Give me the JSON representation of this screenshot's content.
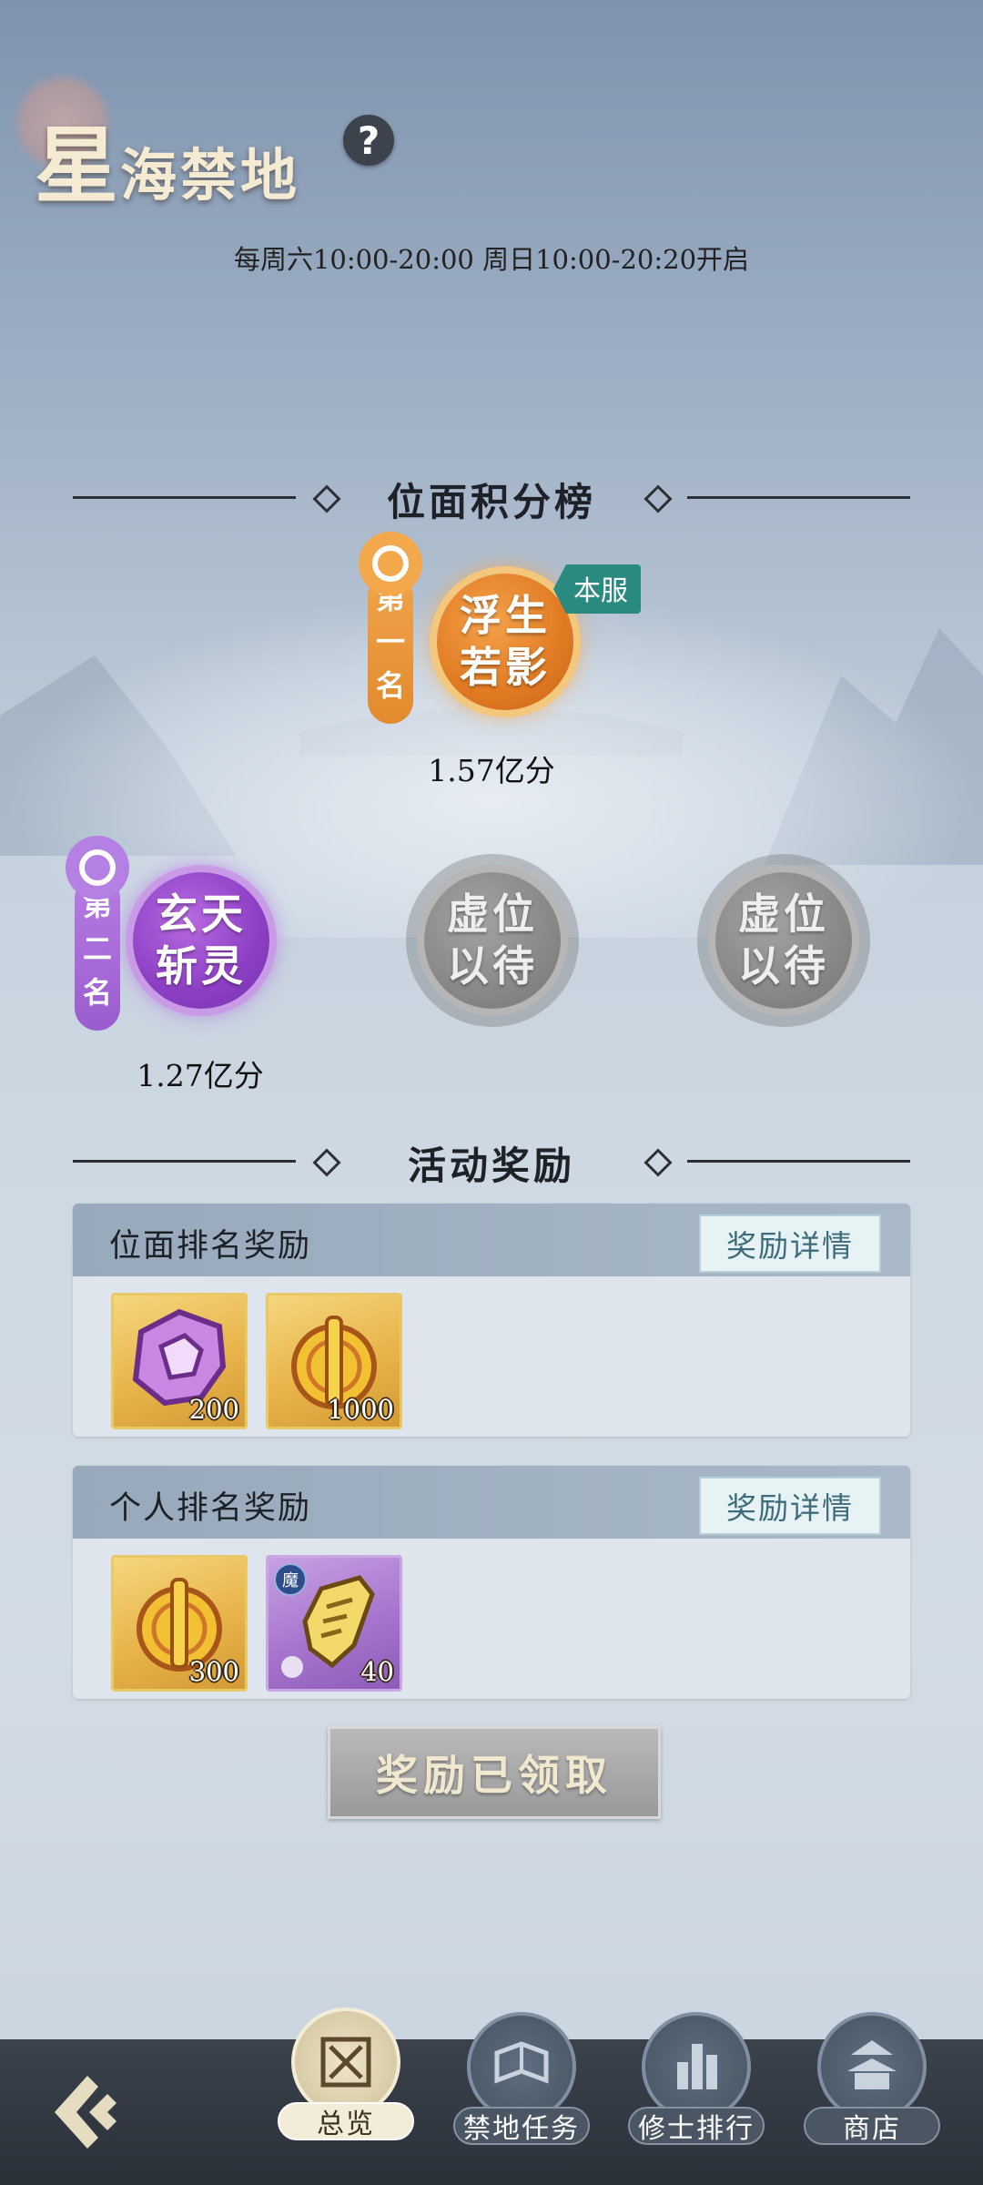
{
  "header": {
    "title_first_char": "星",
    "title_rest": "海禁地",
    "help_icon_glyph": "?",
    "schedule": "每周六10:00-20:00 周日10:00-20:20开启"
  },
  "leaderboard": {
    "title": "位面积分榜",
    "first": {
      "rank_chars": [
        "第",
        "一",
        "名"
      ],
      "name_line1": "浮生",
      "name_line2": "若影",
      "badge": "本服",
      "score": "1.57亿分"
    },
    "second": {
      "rank_chars": [
        "第",
        "二",
        "名"
      ],
      "name_line1": "玄天",
      "name_line2": "斩灵",
      "score": "1.27亿分"
    },
    "vacant": [
      {
        "line1": "虚位",
        "line2": "以待"
      },
      {
        "line1": "虚位",
        "line2": "以待"
      }
    ]
  },
  "rewards": {
    "title": "活动奖励",
    "plane": {
      "title": "位面排名奖励",
      "detail_button": "奖励详情",
      "items": [
        {
          "icon": "purple-crystal-icon",
          "qty": "200"
        },
        {
          "icon": "gold-token-icon",
          "qty": "1000"
        }
      ]
    },
    "personal": {
      "title": "个人排名奖励",
      "detail_button": "奖励详情",
      "items": [
        {
          "icon": "gold-token-icon",
          "qty": "300"
        },
        {
          "icon": "golden-fragment-icon",
          "qty": "40",
          "badge": "魔"
        }
      ]
    },
    "claimed_button": "奖励已领取"
  },
  "nav": {
    "tabs": [
      {
        "label": "总览",
        "icon": "scroll-swords-icon",
        "active": true
      },
      {
        "label": "禁地任务",
        "icon": "book-icon",
        "active": false
      },
      {
        "label": "修士排行",
        "icon": "tower-icon",
        "active": false
      },
      {
        "label": "商店",
        "icon": "pavilion-icon",
        "active": false
      }
    ]
  },
  "colors": {
    "accent_orange": "#e07a22",
    "accent_purple": "#8c3fc4",
    "badge_teal": "#2a8a80",
    "nav_bg": "#2b3139"
  }
}
